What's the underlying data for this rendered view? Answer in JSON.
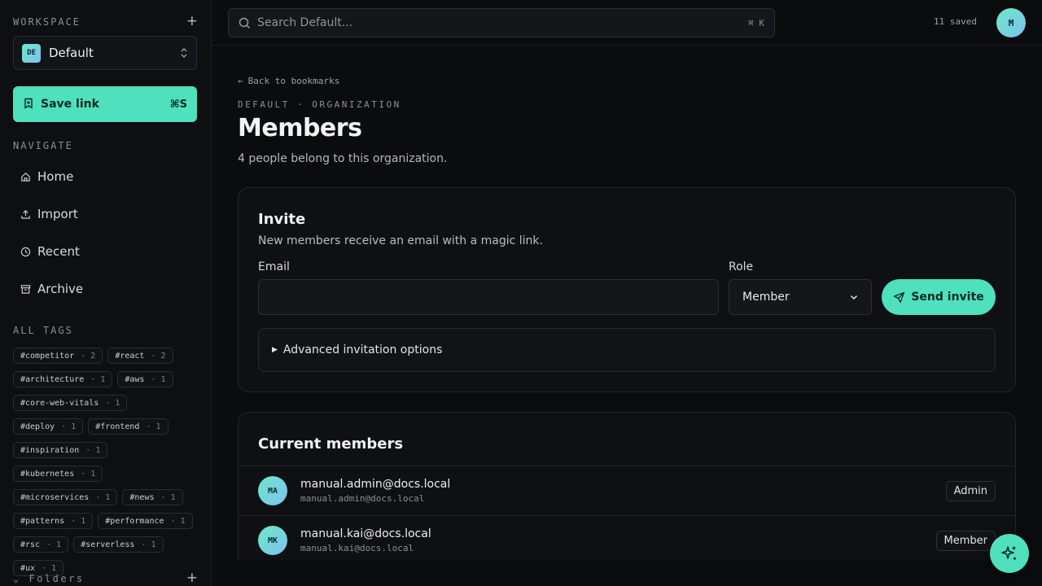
{
  "sidebar": {
    "workspace_label": "WORKSPACE",
    "workspace": {
      "badge": "DE",
      "name": "Default"
    },
    "save_link": {
      "label": "Save link",
      "shortcut": "⌘S"
    },
    "navigate_label": "NAVIGATE",
    "nav": [
      {
        "label": "Home",
        "icon": "home-icon"
      },
      {
        "label": "Import",
        "icon": "upload-icon"
      },
      {
        "label": "Recent",
        "icon": "clock-icon"
      },
      {
        "label": "Archive",
        "icon": "archive-icon"
      }
    ],
    "tags_label": "ALL TAGS",
    "tags": [
      {
        "name": "#competitor",
        "count": "· 2"
      },
      {
        "name": "#react",
        "count": "· 2"
      },
      {
        "name": "#architecture",
        "count": "· 1"
      },
      {
        "name": "#aws",
        "count": "· 1"
      },
      {
        "name": "#core-web-vitals",
        "count": "· 1"
      },
      {
        "name": "#deploy",
        "count": "· 1"
      },
      {
        "name": "#frontend",
        "count": "· 1"
      },
      {
        "name": "#inspiration",
        "count": "· 1"
      },
      {
        "name": "#kubernetes",
        "count": "· 1"
      },
      {
        "name": "#microservices",
        "count": "· 1"
      },
      {
        "name": "#news",
        "count": "· 1"
      },
      {
        "name": "#patterns",
        "count": "· 1"
      },
      {
        "name": "#performance",
        "count": "· 1"
      },
      {
        "name": "#rsc",
        "count": "· 1"
      },
      {
        "name": "#serverless",
        "count": "· 1"
      },
      {
        "name": "#ux",
        "count": "· 1"
      }
    ],
    "folders_label": "Folders"
  },
  "header": {
    "search_placeholder": "Search Default...",
    "search_shortcut": "⌘ K",
    "saved_count": "11 saved",
    "avatar_initial": "M"
  },
  "main": {
    "back_link": "Back to bookmarks",
    "eyebrow": "DEFAULT · ORGANIZATION",
    "title": "Members",
    "subtitle": "4 people belong to this organization.",
    "invite": {
      "title": "Invite",
      "subtitle": "New members receive an email with a magic link.",
      "email_label": "Email",
      "email_value": "",
      "role_label": "Role",
      "role_value": "Member",
      "send_label": "Send invite",
      "advanced_label": "Advanced invitation options"
    },
    "members": {
      "title": "Current members",
      "rows": [
        {
          "initials": "MA",
          "name": "manual.admin@docs.local",
          "email": "manual.admin@docs.local",
          "role": "Admin"
        },
        {
          "initials": "MK",
          "name": "manual.kai@docs.local",
          "email": "manual.kai@docs.local",
          "role": "Member"
        }
      ]
    }
  },
  "colors": {
    "accent": "#4fe0bd",
    "background": "#0b0c0e",
    "sidebar": "#0e0f11"
  }
}
